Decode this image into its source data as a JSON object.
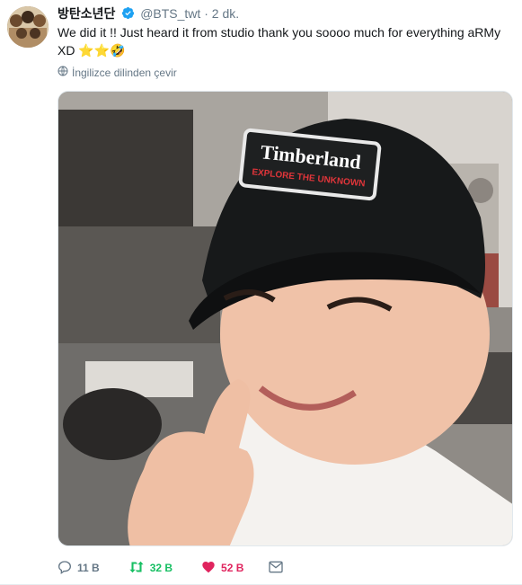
{
  "tweet": {
    "display_name": "방탄소년단",
    "handle": "@BTS_twt",
    "separator": "·",
    "time": "2 dk.",
    "text": "We did it !! Just heard it from studio thank you soooo much for everything aRMy XD ⭐⭐🤣",
    "translate_label": "İngilizce dilinden çevir",
    "photo": {
      "cap_brand": "Timberland",
      "cap_tagline": "EXPLORE THE UNKNOWN"
    }
  },
  "actions": {
    "reply_count": "11 B",
    "retweet_count": "32 B",
    "like_count": "52 B"
  },
  "colors": {
    "verified": "#1da1f2",
    "retweet": "#17bf63",
    "like": "#e0245e",
    "muted": "#657786"
  },
  "icons": [
    "verified-badge-icon",
    "globe-icon",
    "reply-icon",
    "retweet-icon",
    "heart-icon",
    "envelope-icon"
  ]
}
